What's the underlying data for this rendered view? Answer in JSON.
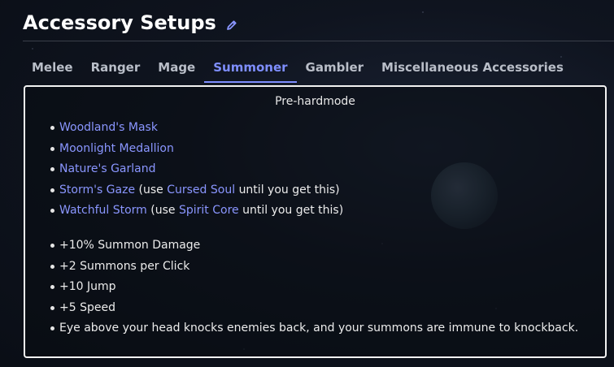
{
  "page": {
    "title": "Accessory Setups",
    "edit_icon": "pencil-icon"
  },
  "tabs": [
    {
      "label": "Melee",
      "active": false
    },
    {
      "label": "Ranger",
      "active": false
    },
    {
      "label": "Mage",
      "active": false
    },
    {
      "label": "Summoner",
      "active": true
    },
    {
      "label": "Gambler",
      "active": false
    },
    {
      "label": "Miscellaneous Accessories",
      "active": false
    }
  ],
  "panel": {
    "title": "Pre-hardmode",
    "items": [
      {
        "name": "Woodland's Mask"
      },
      {
        "name": "Moonlight Medallion"
      },
      {
        "name": "Nature's Garland"
      },
      {
        "name": "Storm's Gaze",
        "pre": "(use",
        "alt": "Cursed Soul",
        "post": "until you get this)"
      },
      {
        "name": "Watchful Storm",
        "pre": "(use",
        "alt": "Spirit Core",
        "post": "until you get this)"
      }
    ],
    "stats": [
      "+10% Summon Damage",
      "+2 Summons per Click",
      "+10 Jump",
      "+5 Speed",
      "Eye above your head knocks enemies back, and your summons are immune to knockback."
    ]
  },
  "colors": {
    "link": "#8a96ff",
    "active_tab": "#7e8eff",
    "border": "#f2f2f2"
  }
}
